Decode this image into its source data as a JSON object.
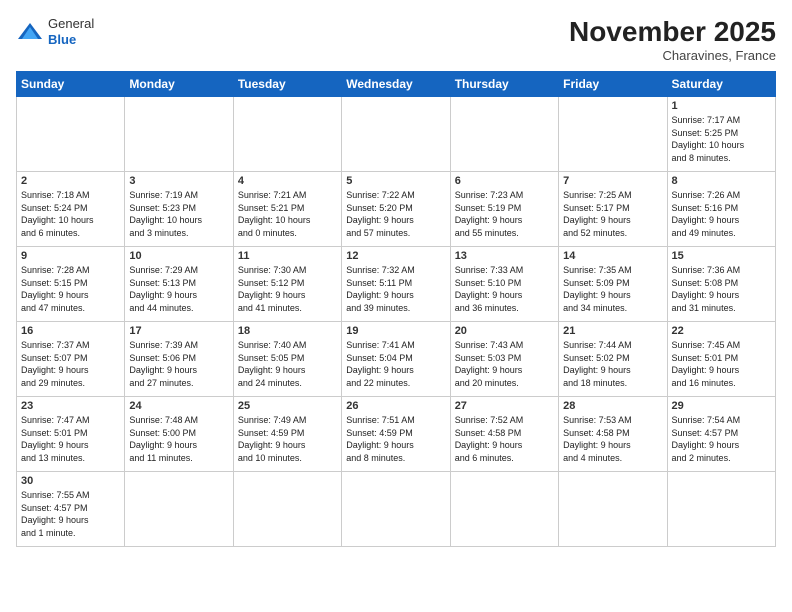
{
  "header": {
    "logo_general": "General",
    "logo_blue": "Blue",
    "month_title": "November 2025",
    "subtitle": "Charavines, France"
  },
  "days_of_week": [
    "Sunday",
    "Monday",
    "Tuesday",
    "Wednesday",
    "Thursday",
    "Friday",
    "Saturday"
  ],
  "weeks": [
    [
      {
        "day": "",
        "info": ""
      },
      {
        "day": "",
        "info": ""
      },
      {
        "day": "",
        "info": ""
      },
      {
        "day": "",
        "info": ""
      },
      {
        "day": "",
        "info": ""
      },
      {
        "day": "",
        "info": ""
      },
      {
        "day": "1",
        "info": "Sunrise: 7:17 AM\nSunset: 5:25 PM\nDaylight: 10 hours\nand 8 minutes."
      }
    ],
    [
      {
        "day": "2",
        "info": "Sunrise: 7:18 AM\nSunset: 5:24 PM\nDaylight: 10 hours\nand 6 minutes."
      },
      {
        "day": "3",
        "info": "Sunrise: 7:19 AM\nSunset: 5:23 PM\nDaylight: 10 hours\nand 3 minutes."
      },
      {
        "day": "4",
        "info": "Sunrise: 7:21 AM\nSunset: 5:21 PM\nDaylight: 10 hours\nand 0 minutes."
      },
      {
        "day": "5",
        "info": "Sunrise: 7:22 AM\nSunset: 5:20 PM\nDaylight: 9 hours\nand 57 minutes."
      },
      {
        "day": "6",
        "info": "Sunrise: 7:23 AM\nSunset: 5:19 PM\nDaylight: 9 hours\nand 55 minutes."
      },
      {
        "day": "7",
        "info": "Sunrise: 7:25 AM\nSunset: 5:17 PM\nDaylight: 9 hours\nand 52 minutes."
      },
      {
        "day": "8",
        "info": "Sunrise: 7:26 AM\nSunset: 5:16 PM\nDaylight: 9 hours\nand 49 minutes."
      }
    ],
    [
      {
        "day": "9",
        "info": "Sunrise: 7:28 AM\nSunset: 5:15 PM\nDaylight: 9 hours\nand 47 minutes."
      },
      {
        "day": "10",
        "info": "Sunrise: 7:29 AM\nSunset: 5:13 PM\nDaylight: 9 hours\nand 44 minutes."
      },
      {
        "day": "11",
        "info": "Sunrise: 7:30 AM\nSunset: 5:12 PM\nDaylight: 9 hours\nand 41 minutes."
      },
      {
        "day": "12",
        "info": "Sunrise: 7:32 AM\nSunset: 5:11 PM\nDaylight: 9 hours\nand 39 minutes."
      },
      {
        "day": "13",
        "info": "Sunrise: 7:33 AM\nSunset: 5:10 PM\nDaylight: 9 hours\nand 36 minutes."
      },
      {
        "day": "14",
        "info": "Sunrise: 7:35 AM\nSunset: 5:09 PM\nDaylight: 9 hours\nand 34 minutes."
      },
      {
        "day": "15",
        "info": "Sunrise: 7:36 AM\nSunset: 5:08 PM\nDaylight: 9 hours\nand 31 minutes."
      }
    ],
    [
      {
        "day": "16",
        "info": "Sunrise: 7:37 AM\nSunset: 5:07 PM\nDaylight: 9 hours\nand 29 minutes."
      },
      {
        "day": "17",
        "info": "Sunrise: 7:39 AM\nSunset: 5:06 PM\nDaylight: 9 hours\nand 27 minutes."
      },
      {
        "day": "18",
        "info": "Sunrise: 7:40 AM\nSunset: 5:05 PM\nDaylight: 9 hours\nand 24 minutes."
      },
      {
        "day": "19",
        "info": "Sunrise: 7:41 AM\nSunset: 5:04 PM\nDaylight: 9 hours\nand 22 minutes."
      },
      {
        "day": "20",
        "info": "Sunrise: 7:43 AM\nSunset: 5:03 PM\nDaylight: 9 hours\nand 20 minutes."
      },
      {
        "day": "21",
        "info": "Sunrise: 7:44 AM\nSunset: 5:02 PM\nDaylight: 9 hours\nand 18 minutes."
      },
      {
        "day": "22",
        "info": "Sunrise: 7:45 AM\nSunset: 5:01 PM\nDaylight: 9 hours\nand 16 minutes."
      }
    ],
    [
      {
        "day": "23",
        "info": "Sunrise: 7:47 AM\nSunset: 5:01 PM\nDaylight: 9 hours\nand 13 minutes."
      },
      {
        "day": "24",
        "info": "Sunrise: 7:48 AM\nSunset: 5:00 PM\nDaylight: 9 hours\nand 11 minutes."
      },
      {
        "day": "25",
        "info": "Sunrise: 7:49 AM\nSunset: 4:59 PM\nDaylight: 9 hours\nand 10 minutes."
      },
      {
        "day": "26",
        "info": "Sunrise: 7:51 AM\nSunset: 4:59 PM\nDaylight: 9 hours\nand 8 minutes."
      },
      {
        "day": "27",
        "info": "Sunrise: 7:52 AM\nSunset: 4:58 PM\nDaylight: 9 hours\nand 6 minutes."
      },
      {
        "day": "28",
        "info": "Sunrise: 7:53 AM\nSunset: 4:58 PM\nDaylight: 9 hours\nand 4 minutes."
      },
      {
        "day": "29",
        "info": "Sunrise: 7:54 AM\nSunset: 4:57 PM\nDaylight: 9 hours\nand 2 minutes."
      }
    ],
    [
      {
        "day": "30",
        "info": "Sunrise: 7:55 AM\nSunset: 4:57 PM\nDaylight: 9 hours\nand 1 minute."
      },
      {
        "day": "",
        "info": ""
      },
      {
        "day": "",
        "info": ""
      },
      {
        "day": "",
        "info": ""
      },
      {
        "day": "",
        "info": ""
      },
      {
        "day": "",
        "info": ""
      },
      {
        "day": "",
        "info": ""
      }
    ]
  ]
}
